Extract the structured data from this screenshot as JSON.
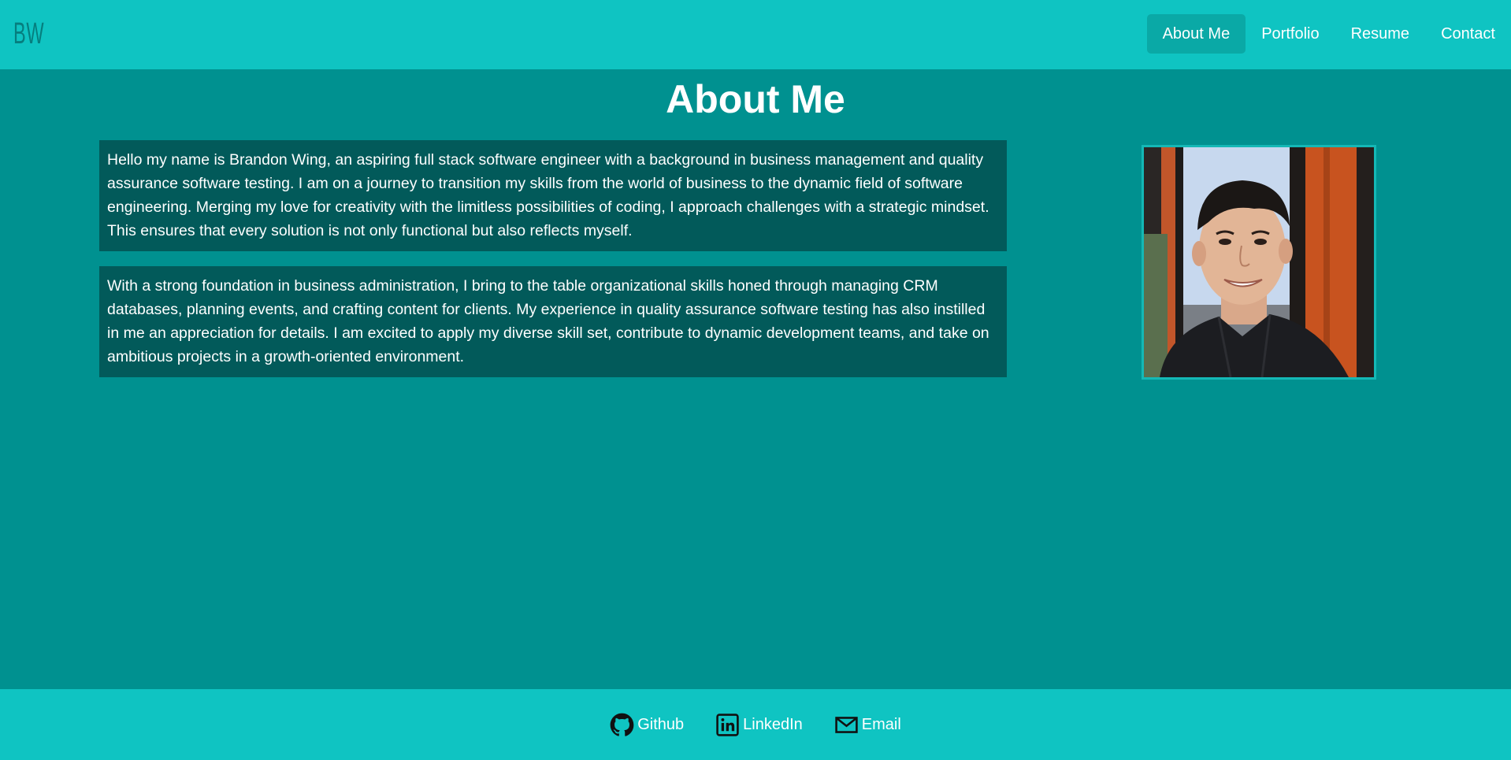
{
  "header": {
    "logo": "BW",
    "nav": [
      {
        "label": "About Me",
        "active": true
      },
      {
        "label": "Portfolio",
        "active": false
      },
      {
        "label": "Resume",
        "active": false
      },
      {
        "label": "Contact",
        "active": false
      }
    ]
  },
  "main": {
    "title": "About Me",
    "paragraphs": [
      "Hello my name is Brandon Wing, an aspiring full stack software engineer with a background in business management and quality assurance software testing. I am on a journey to transition my skills from the world of business to the dynamic field of software engineering. Merging my love for creativity with the limitless possibilities of coding, I approach challenges with a strategic mindset. This ensures that every solution is not only functional but also reflects myself.",
      "With a strong foundation in business administration, I bring to the table organizational skills honed through managing CRM databases, planning events, and crafting content for clients. My experience in quality assurance software testing has also instilled in me an appreciation for details. I am excited to apply my diverse skill set, contribute to dynamic development teams, and take on ambitious projects in a growth-oriented environment."
    ]
  },
  "footer": {
    "links": [
      {
        "label": "Github",
        "icon": "github-icon"
      },
      {
        "label": "LinkedIn",
        "icon": "linkedin-icon"
      },
      {
        "label": "Email",
        "icon": "email-icon"
      }
    ]
  },
  "colors": {
    "header_bg": "#0fc4c2",
    "page_bg": "#009190",
    "paragraph_bg": "#025a5a",
    "active_nav_bg": "#0aa9a6",
    "logo": "#067e7e"
  }
}
